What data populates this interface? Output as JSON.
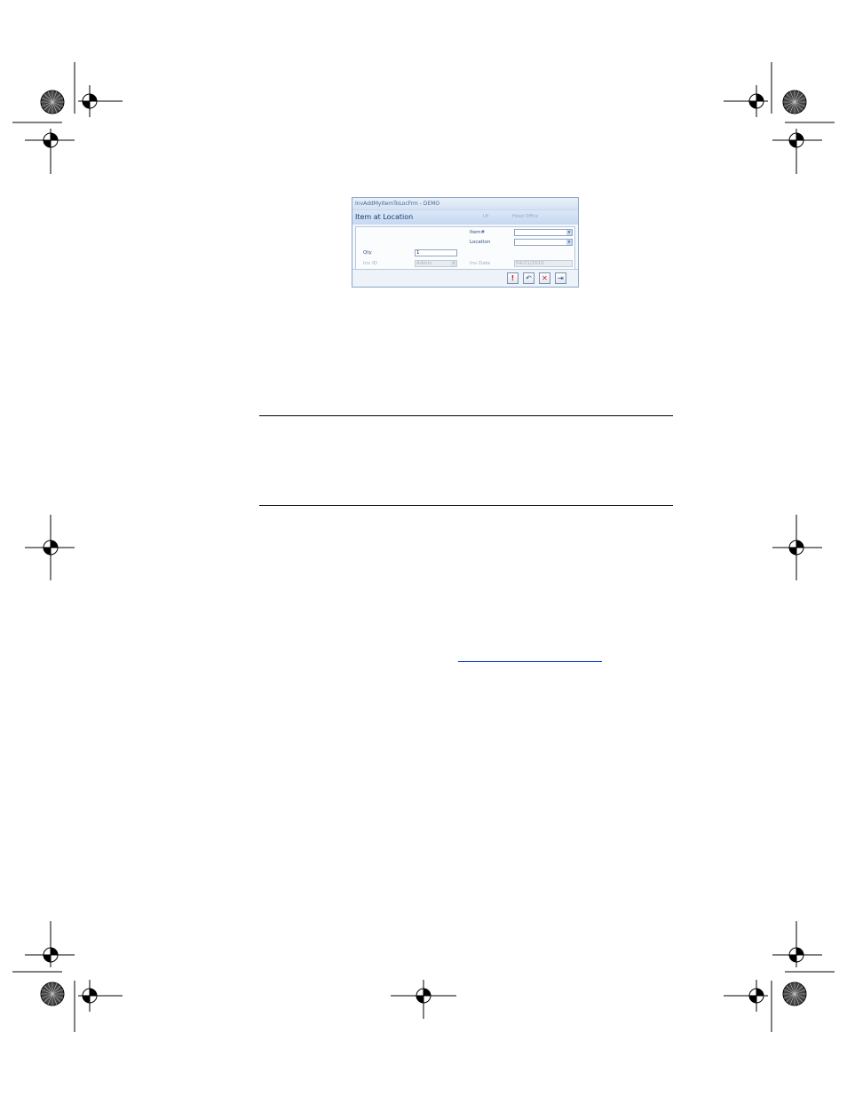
{
  "dialog": {
    "window_title": "InvAddMyItemToLocFrm - DEMO",
    "heading": "Item at Location",
    "user": "LH",
    "location": "Head Office",
    "fields": {
      "item_label": "Item#",
      "item_value": "",
      "location_label": "Location",
      "location_value": "",
      "qty_label": "Qty",
      "qty_value": "1",
      "invid_label": "Inv ID",
      "invid_value": "Admin",
      "invdate_label": "Inv Date",
      "invdate_value": "04/21/2010"
    },
    "buttons": {
      "save_glyph": "!",
      "undo_glyph": "↶",
      "delete_glyph": "✕",
      "exit_glyph": "⇥"
    }
  },
  "colors": {
    "accent": "#1b3f73",
    "delete_red": "#cc2222",
    "save_red": "#cc2222",
    "link_blue": "#0033cc"
  },
  "icons": [
    "registration-mark-icon",
    "color-target-icon"
  ]
}
